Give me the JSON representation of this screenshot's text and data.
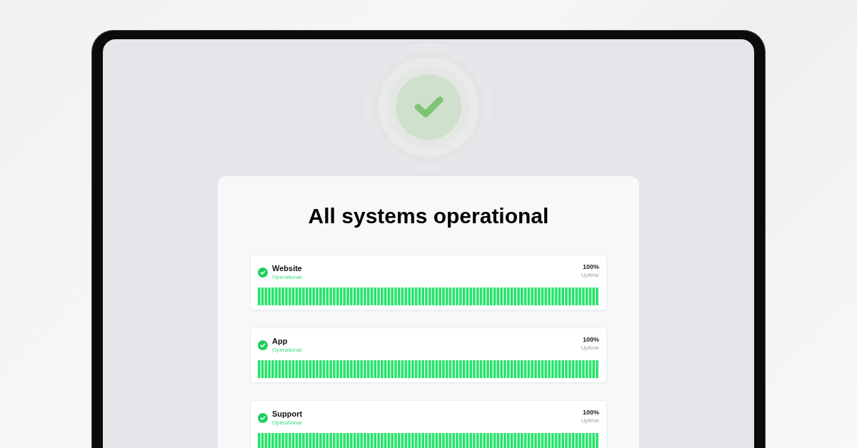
{
  "headline": "All systems operational",
  "services": [
    {
      "name": "Website",
      "status": "Operational",
      "uptime": "100%",
      "uptime_label": "Uptime"
    },
    {
      "name": "App",
      "status": "Operational",
      "uptime": "100%",
      "uptime_label": "Uptime"
    },
    {
      "name": "Support",
      "status": "Operational",
      "uptime": "100%",
      "uptime_label": "Uptime"
    }
  ]
}
